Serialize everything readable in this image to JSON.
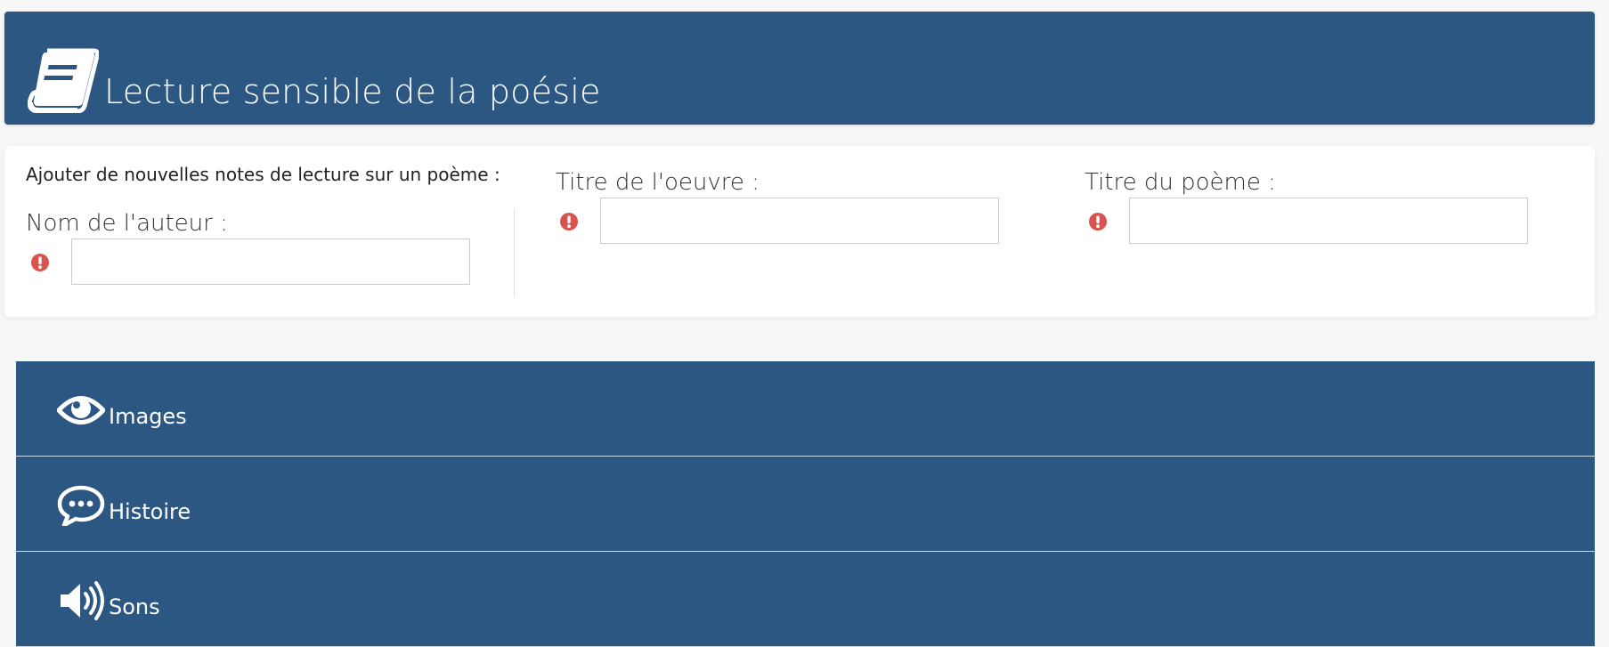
{
  "header": {
    "title": "Lecture sensible de la poésie",
    "icon": "book-icon"
  },
  "form": {
    "intro": "Ajouter de nouvelles notes de lecture sur un poème :",
    "author": {
      "label": "Nom de l'auteur :",
      "value": ""
    },
    "work": {
      "label": "Titre de l'oeuvre :",
      "value": ""
    },
    "poem": {
      "label": "Titre du poème :",
      "value": ""
    },
    "warning_icon": "exclamation-circle-icon"
  },
  "accordion": {
    "items": [
      {
        "label": "Images",
        "icon": "eye-icon"
      },
      {
        "label": "Histoire",
        "icon": "speech-bubble-icon"
      },
      {
        "label": "Sons",
        "icon": "volume-icon"
      }
    ]
  },
  "colors": {
    "primary": "#2c5782",
    "warning": "#d9534f",
    "background": "#f7f7f7"
  }
}
